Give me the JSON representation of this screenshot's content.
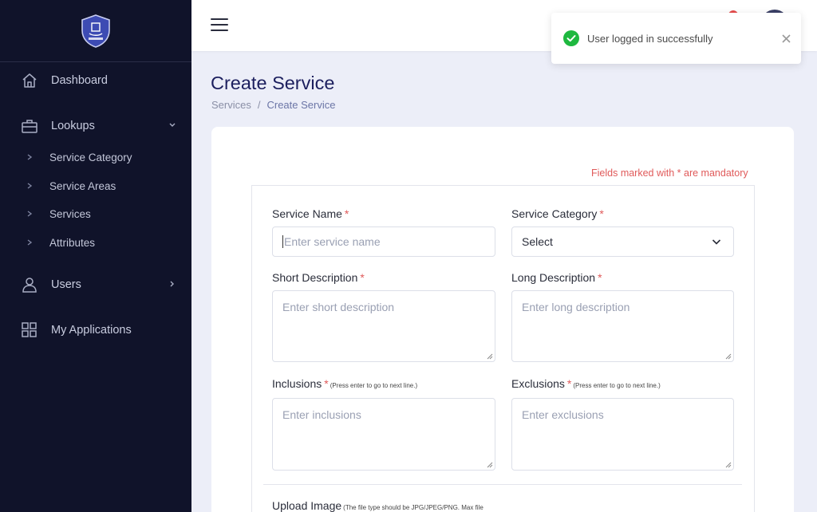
{
  "sidebar": {
    "items": [
      {
        "label": "Dashboard",
        "icon": "home-icon"
      },
      {
        "label": "Lookups",
        "icon": "briefcase-icon",
        "expanded": true
      },
      {
        "label": "Users",
        "icon": "user-icon"
      },
      {
        "label": "My Applications",
        "icon": "grid-icon"
      }
    ],
    "sub_items": [
      {
        "label": "Service Category"
      },
      {
        "label": "Service Areas"
      },
      {
        "label": "Services"
      },
      {
        "label": "Attributes"
      }
    ]
  },
  "toast": {
    "message": "User logged in successfully",
    "icon": "check-circle-icon",
    "color": "#1eb83f"
  },
  "page": {
    "title": "Create Service",
    "breadcrumb": [
      "Services",
      "/",
      "Create Service"
    ]
  },
  "form": {
    "mandatory_note": "Fields marked with * are mandatory",
    "service_name": {
      "label": "Service Name",
      "required": "*",
      "placeholder": "Enter service name"
    },
    "service_category": {
      "label": "Service Category",
      "required": "*",
      "value": "Select"
    },
    "short_description": {
      "label": "Short Description",
      "required": "*",
      "placeholder": "Enter short description"
    },
    "long_description": {
      "label": "Long Description",
      "required": "*",
      "placeholder": "Enter long description"
    },
    "inclusions": {
      "label": "Inclusions",
      "required": "*",
      "hint": "(Press enter to go to next line.)",
      "placeholder": "Enter inclusions"
    },
    "exclusions": {
      "label": "Exclusions",
      "required": "*",
      "hint": "(Press enter to go to next line.)",
      "placeholder": "Enter exclusions"
    },
    "upload_image": {
      "label": "Upload Image",
      "hint": "(The file type should be JPG/JPEG/PNG. Max file"
    }
  },
  "colors": {
    "sidebar_bg": "#10132a",
    "accent": "#1c1f5e",
    "required": "#e05a5a",
    "notification": "#e74c4c"
  }
}
